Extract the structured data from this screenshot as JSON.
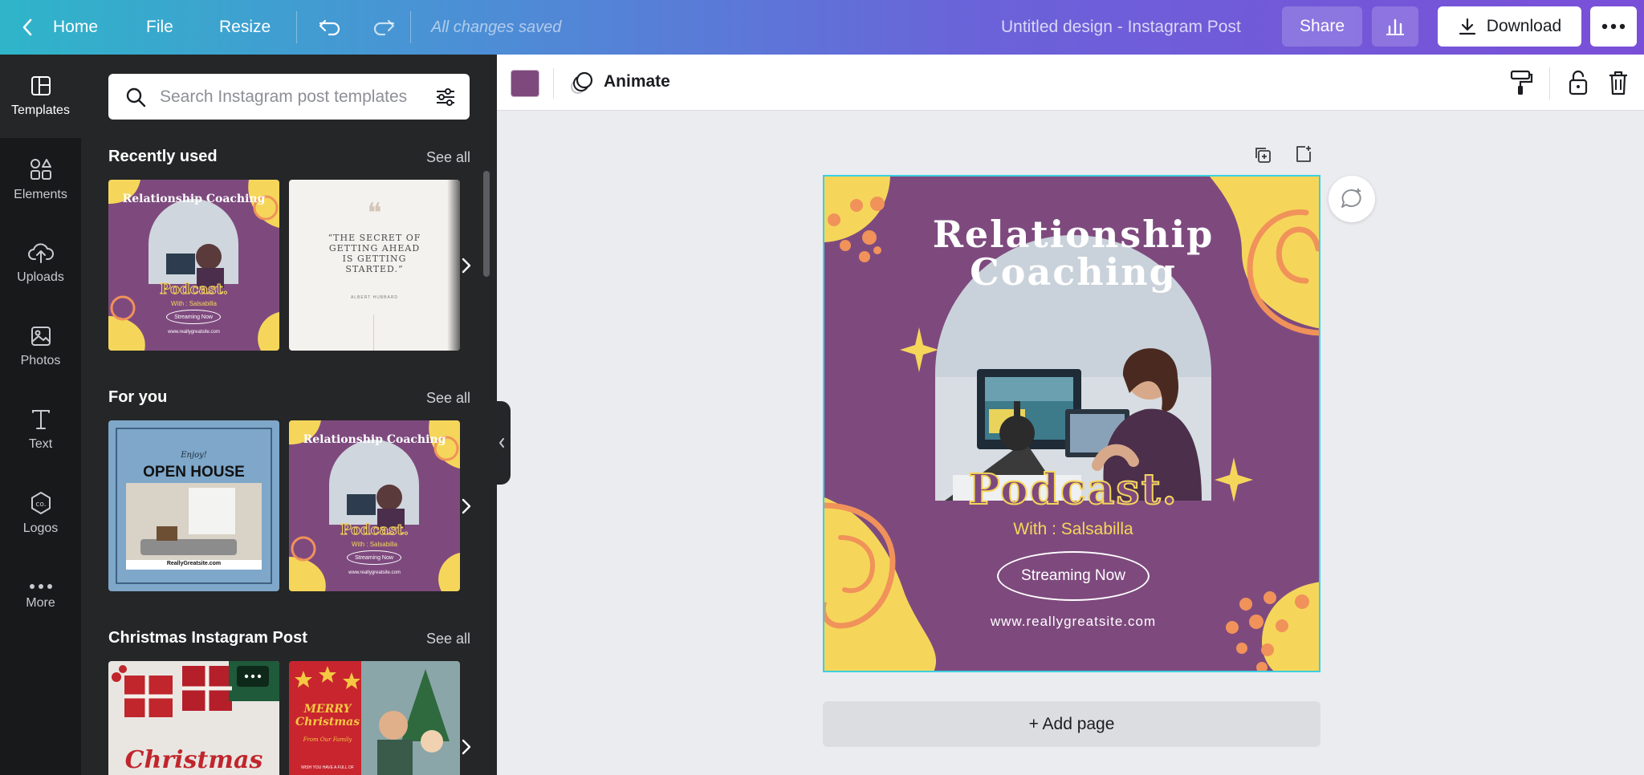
{
  "topbar": {
    "home": "Home",
    "file": "File",
    "resize": "Resize",
    "status": "All changes saved",
    "title": "Untitled design - Instagram Post",
    "share": "Share",
    "download": "Download"
  },
  "rail": {
    "items": [
      {
        "label": "Templates",
        "icon": "templates-icon"
      },
      {
        "label": "Elements",
        "icon": "elements-icon"
      },
      {
        "label": "Uploads",
        "icon": "uploads-icon"
      },
      {
        "label": "Photos",
        "icon": "photos-icon"
      },
      {
        "label": "Text",
        "icon": "text-icon"
      },
      {
        "label": "Logos",
        "icon": "logos-icon"
      },
      {
        "label": "More",
        "icon": "more-icon"
      }
    ]
  },
  "panel": {
    "search_placeholder": "Search Instagram post templates",
    "see_all": "See all",
    "sections": [
      {
        "title": "Recently used"
      },
      {
        "title": "For you"
      },
      {
        "title": "Christmas Instagram Post"
      }
    ],
    "thumbs": {
      "t1_title": "Relationship Coaching",
      "t1_pod": "Podcast.",
      "t1_with": "With : Salsabilla",
      "t1_stream": "Streaming Now",
      "t1_url": "www.reallygreatsite.com",
      "t2_quote": "“THE SECRET OF GETTING AHEAD IS GETTING STARTED.”",
      "t2_author": "ALBERT HUBBARD",
      "t3_script": "Enjoy!",
      "t3_title": "OPEN HOUSE",
      "t3_url": "ReallyGreatsite.com",
      "t5_script": "Christmas",
      "t6_title": "MERRY Christmas",
      "t6_sub": "From Our Family",
      "t6_foot": "WISH YOU HAVE A FULL OF"
    }
  },
  "context": {
    "color": "#7e4a7e",
    "animate": "Animate"
  },
  "design": {
    "title_line1": "Relationship",
    "title_line2": "Coaching",
    "podcast": "Podcast.",
    "with": "With : Salsabilla",
    "stream": "Streaming Now",
    "url": "www.reallygreatsite.com"
  },
  "add_page": "+ Add page",
  "colors": {
    "accent_purple": "#7e4a7e",
    "yellow": "#f5d65a",
    "orange": "#f0925a",
    "selection": "#3bd0e0"
  }
}
